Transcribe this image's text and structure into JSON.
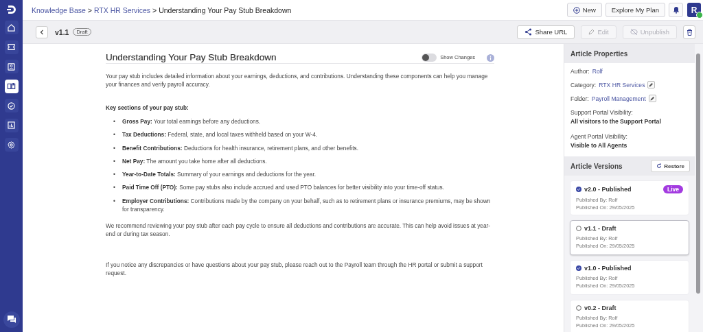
{
  "sidebar": {
    "items": [
      {
        "selected": false
      },
      {
        "selected": false
      },
      {
        "selected": false
      },
      {
        "selected": true
      },
      {
        "selected": false
      },
      {
        "selected": false
      },
      {
        "selected": false
      }
    ]
  },
  "breadcrumb": [
    {
      "text": "Knowledge Base",
      "link": true
    },
    {
      "text": ">",
      "link": false
    },
    {
      "text": "RTX HR Services",
      "link": true
    },
    {
      "text": ">",
      "link": false
    },
    {
      "text": "Understanding Your Pay Stub Breakdown",
      "link": false
    }
  ],
  "header_buttons": [
    {
      "label": "New"
    },
    {
      "label": "Explore My Plan"
    }
  ],
  "avatar": {
    "letter": "R",
    "online": true
  },
  "toolbar": {
    "version": "v1.1",
    "badge": "Draft",
    "buttons": [
      {
        "label": "Share URL",
        "disabled": false
      },
      {
        "label": "Edit",
        "disabled": true
      },
      {
        "label": "Unpublish",
        "disabled": true
      }
    ]
  },
  "article": {
    "title": "Understanding Your Pay Stub Breakdown",
    "toggle": {
      "label": "Show Changes",
      "on": false
    },
    "blocks": [
      {
        "kind": "para",
        "text": "Your pay stub includes detailed information about your earnings, deductions, and contributions. Understanding these components can help you manage your finances and verify payroll accuracy."
      },
      {
        "kind": "heading",
        "text": "Key sections of your pay stub:"
      },
      {
        "kind": "list",
        "items": [
          {
            "marker": "•",
            "text": "**Gross Pay:** Your total earnings before any deductions."
          },
          {
            "marker": "•",
            "text": "**Tax Deductions:** Federal, state, and local taxes withheld based on your W-4."
          },
          {
            "marker": "•",
            "text": "**Benefit Contributions:** Deductions for health insurance, retirement plans, and other benefits."
          },
          {
            "marker": "•",
            "text": "**Net Pay:** The amount you take home after all deductions."
          },
          {
            "marker": "•",
            "text": "**Year-to-Date Totals:** Summary of your earnings and deductions for the year."
          },
          {
            "marker": "•",
            "text": "**Paid Time Off (PTO):** Some pay stubs also include accrued and used PTO balances for better visibility into your time-off status."
          },
          {
            "marker": "•",
            "text": "**Employer Contributions:** Contributions made by the company on your behalf, such as to retirement plans or insurance premiums, may be shown for transparency."
          }
        ]
      },
      {
        "kind": "para",
        "text": "We recommend reviewing your pay stub after each pay cycle to ensure all deductions and contributions are accurate. This can help avoid issues at year-end or during tax season."
      },
      {
        "kind": "gap"
      },
      {
        "kind": "para",
        "text": "If you notice any discrepancies or have questions about your pay stub, please reach out to the Payroll team through the HR portal or submit a support request."
      }
    ]
  },
  "properties": {
    "title": "Article Properties",
    "rows": [
      {
        "kind": "inline",
        "label": "Author:",
        "value": "Rolf",
        "editable": false
      },
      {
        "kind": "inline",
        "label": "Category:",
        "value": "RTX HR Services",
        "editable": true
      },
      {
        "kind": "inline",
        "label": "Folder:",
        "value": "Payroll Management",
        "editable": true
      },
      {
        "kind": "block",
        "label": "Support Portal Visibility:",
        "value": "All visitors to the Support Portal"
      },
      {
        "kind": "block",
        "label": "Agent Portal Visibility:",
        "value": "Visible to All Agents"
      }
    ]
  },
  "versions": {
    "title": "Article Versions",
    "restore": "Restore",
    "items": [
      {
        "version": "v2.0 -",
        "status": "Published",
        "published": true,
        "live": "Live",
        "selected": false,
        "by": "Published By: Rolf",
        "on": "Published On: 29/05/2025"
      },
      {
        "version": "v1.1 -",
        "status": "Draft",
        "published": false,
        "selected": true,
        "by": "Published By: Rolf",
        "on": "Published On: 29/05/2025"
      },
      {
        "version": "v1.0 -",
        "status": "Published",
        "published": true,
        "selected": false,
        "by": "Published By: Rolf",
        "on": "Published On: 29/05/2025"
      },
      {
        "version": "v0.2 -",
        "status": "Draft",
        "published": false,
        "selected": false,
        "by": "Published By: Rolf",
        "on": "Published On: 29/05/2025"
      }
    ]
  }
}
